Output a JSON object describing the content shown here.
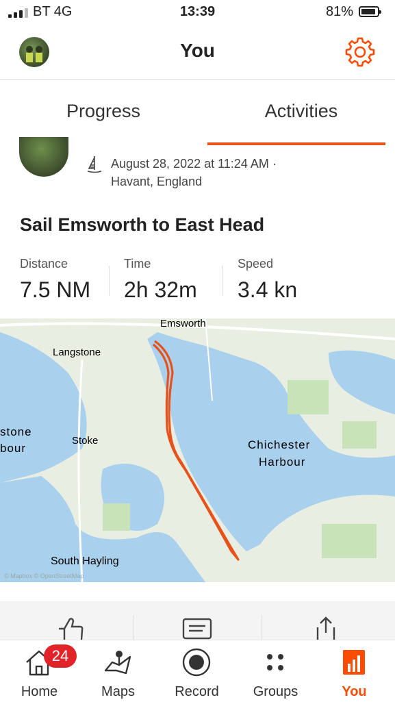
{
  "status_bar": {
    "carrier": "BT  4G",
    "time": "13:39",
    "battery": "81%"
  },
  "header": {
    "title": "You"
  },
  "tabs": [
    {
      "label": "Progress"
    },
    {
      "label": "Activities"
    }
  ],
  "activity": {
    "date_line": "August 28, 2022 at 11:24 AM ·",
    "location": "Havant, England",
    "title": "Sail Emsworth to East Head",
    "stats": [
      {
        "label": "Distance",
        "value": "7.5 NM"
      },
      {
        "label": "Time",
        "value": "2h 32m"
      },
      {
        "label": "Speed",
        "value": "3.4 kn"
      }
    ],
    "map": {
      "labels": {
        "emsworth": "Emsworth",
        "langstone": "Langstone",
        "stone": "stone",
        "bour": "bour",
        "stoke": "Stoke",
        "chichester": "Chichester",
        "harbour": "Harbour",
        "south_hayling": "South Hayling",
        "attribution": "© Mapbox © OpenStreetMap"
      },
      "route_color": "#e8521a"
    }
  },
  "bottom_nav": {
    "badge": "24",
    "items": [
      {
        "label": "Home",
        "icon": "home-icon"
      },
      {
        "label": "Maps",
        "icon": "maps-icon"
      },
      {
        "label": "Record",
        "icon": "record-icon"
      },
      {
        "label": "Groups",
        "icon": "groups-icon"
      },
      {
        "label": "You",
        "icon": "you-icon"
      }
    ],
    "active_color": "#fc4c02"
  }
}
